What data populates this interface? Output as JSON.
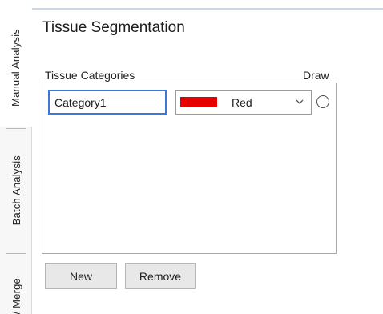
{
  "vertical_tabs": [
    {
      "label": "Manual Analysis",
      "active": true
    },
    {
      "label": "Batch Analysis",
      "active": false
    },
    {
      "label": "/ Merge",
      "active": false
    }
  ],
  "panel": {
    "title": "Tissue Segmentation",
    "columns": {
      "categories": "Tissue Categories",
      "draw": "Draw"
    },
    "rows": [
      {
        "name": "Category1",
        "color_label": "Red",
        "color_hex": "#e60000",
        "draw_selected": false
      }
    ],
    "buttons": {
      "new": "New",
      "remove": "Remove"
    }
  },
  "colors": {
    "input_focus_border": "#3c78d8",
    "button_bg": "#e8e8e8"
  },
  "icons": {
    "dropdown": "chevron-down-icon",
    "draw": "radio-button"
  }
}
